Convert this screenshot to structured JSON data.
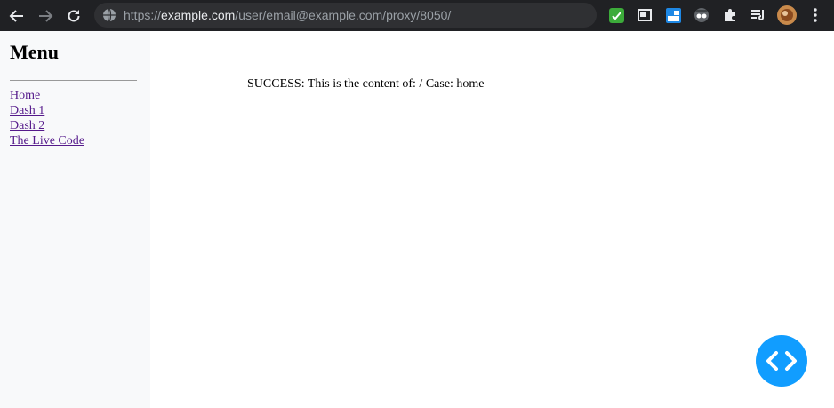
{
  "browser": {
    "url_prefix": "https://",
    "url_host": "example.com",
    "url_path": "/user/email@example.com/proxy/8050/",
    "extensions": [
      "checkmark-extension-icon",
      "picture-in-picture-icon",
      "cloud-extension-icon",
      "spy-extension-icon",
      "puzzle-extensions-icon",
      "reading-list-icon",
      "profile-avatar",
      "kebab-menu-icon"
    ]
  },
  "sidebar": {
    "title": "Menu",
    "links": [
      {
        "label": "Home"
      },
      {
        "label": "Dash 1"
      },
      {
        "label": "Dash 2"
      },
      {
        "label": "The Live Code"
      }
    ]
  },
  "content": {
    "message": "SUCCESS: This is the content of: / Case: home"
  },
  "colors": {
    "toolbar_bg": "#202124",
    "sidebar_bg": "#f8f9fa",
    "link": "#551a8b",
    "fab": "#119dff"
  }
}
